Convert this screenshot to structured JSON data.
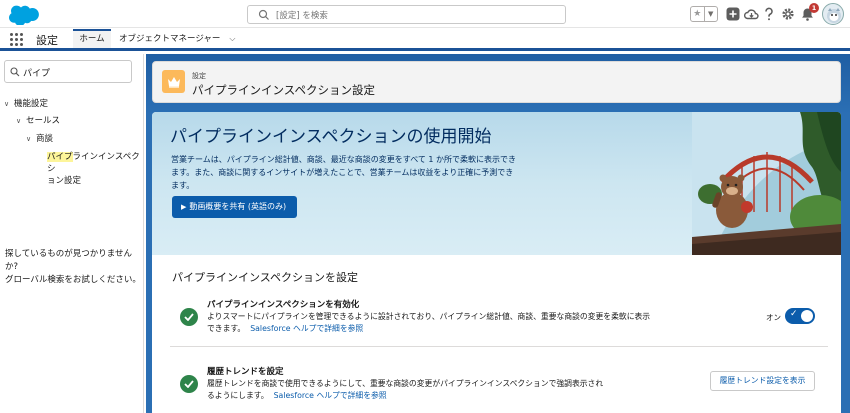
{
  "header": {
    "search_placeholder": "[設定] を検索",
    "notification_count": "1",
    "favorites_icon": "star-icon",
    "icons": [
      "add-icon",
      "trailhead-icon",
      "help-icon",
      "gear-icon",
      "bell-icon"
    ]
  },
  "nav": {
    "app_name": "設定",
    "tabs": [
      "ホーム",
      "オブジェクトマネージャー"
    ]
  },
  "sidebar": {
    "quick_find_value": "パイプ",
    "tree": [
      {
        "label": "機能設定",
        "level": 0
      },
      {
        "label": "セールス",
        "level": 1
      },
      {
        "label": "商談",
        "level": 2
      }
    ],
    "selected_item_line1": "パイプラインインスペクシ",
    "selected_item_line2": "ョン設定",
    "highlight_text": "パイプ",
    "help_text_1": "探しているものが見つかりませんか?",
    "help_text_2": "グローバル検索をお試しください。"
  },
  "page_header": {
    "eyebrow": "設定",
    "title": "パイプラインインスペクション設定"
  },
  "hero": {
    "title": "パイプラインインスペクションの使用開始",
    "line1": "営業チームは、パイプライン総計値、商談、最近な商談の変更をすべて 1 か所で柔軟に表示でき",
    "line2": "ます。また、商談に関するインサイトが増えたことで、営業チームは収益をより正確に予測でき",
    "line3": "ます。",
    "button_label": "動画概要を共有 (英語のみ)"
  },
  "settings": {
    "section_title": "パイプラインインスペクションを設定",
    "enable": {
      "title": "パイプラインインスペクションを有効化",
      "desc_line1": "よりスマートにパイプラインを管理できるように設計されており、パイプライン総計値、商談、重要な商談の変更を柔軟に表示",
      "desc_line2": "できます。",
      "link": "Salesforce ヘルプで詳細を参照",
      "toggle_label": "オン",
      "toggle_on": true
    },
    "trend": {
      "title": "履歴トレンドを設定",
      "desc_line1": "履歴トレンドを商談で使用できるようにして、重要な商談の変更がパイプラインインスペクションで強調表示され",
      "desc_line2": "るようにします。",
      "link": "Salesforce ヘルプで詳細を参照",
      "button_label": "履歴トレンド設定を表示"
    }
  },
  "colors": {
    "brand_blue": "#0b5cab",
    "nav_blue": "#1b5297",
    "success_green": "#2e844a",
    "crown_orange": "#fcb95b"
  }
}
